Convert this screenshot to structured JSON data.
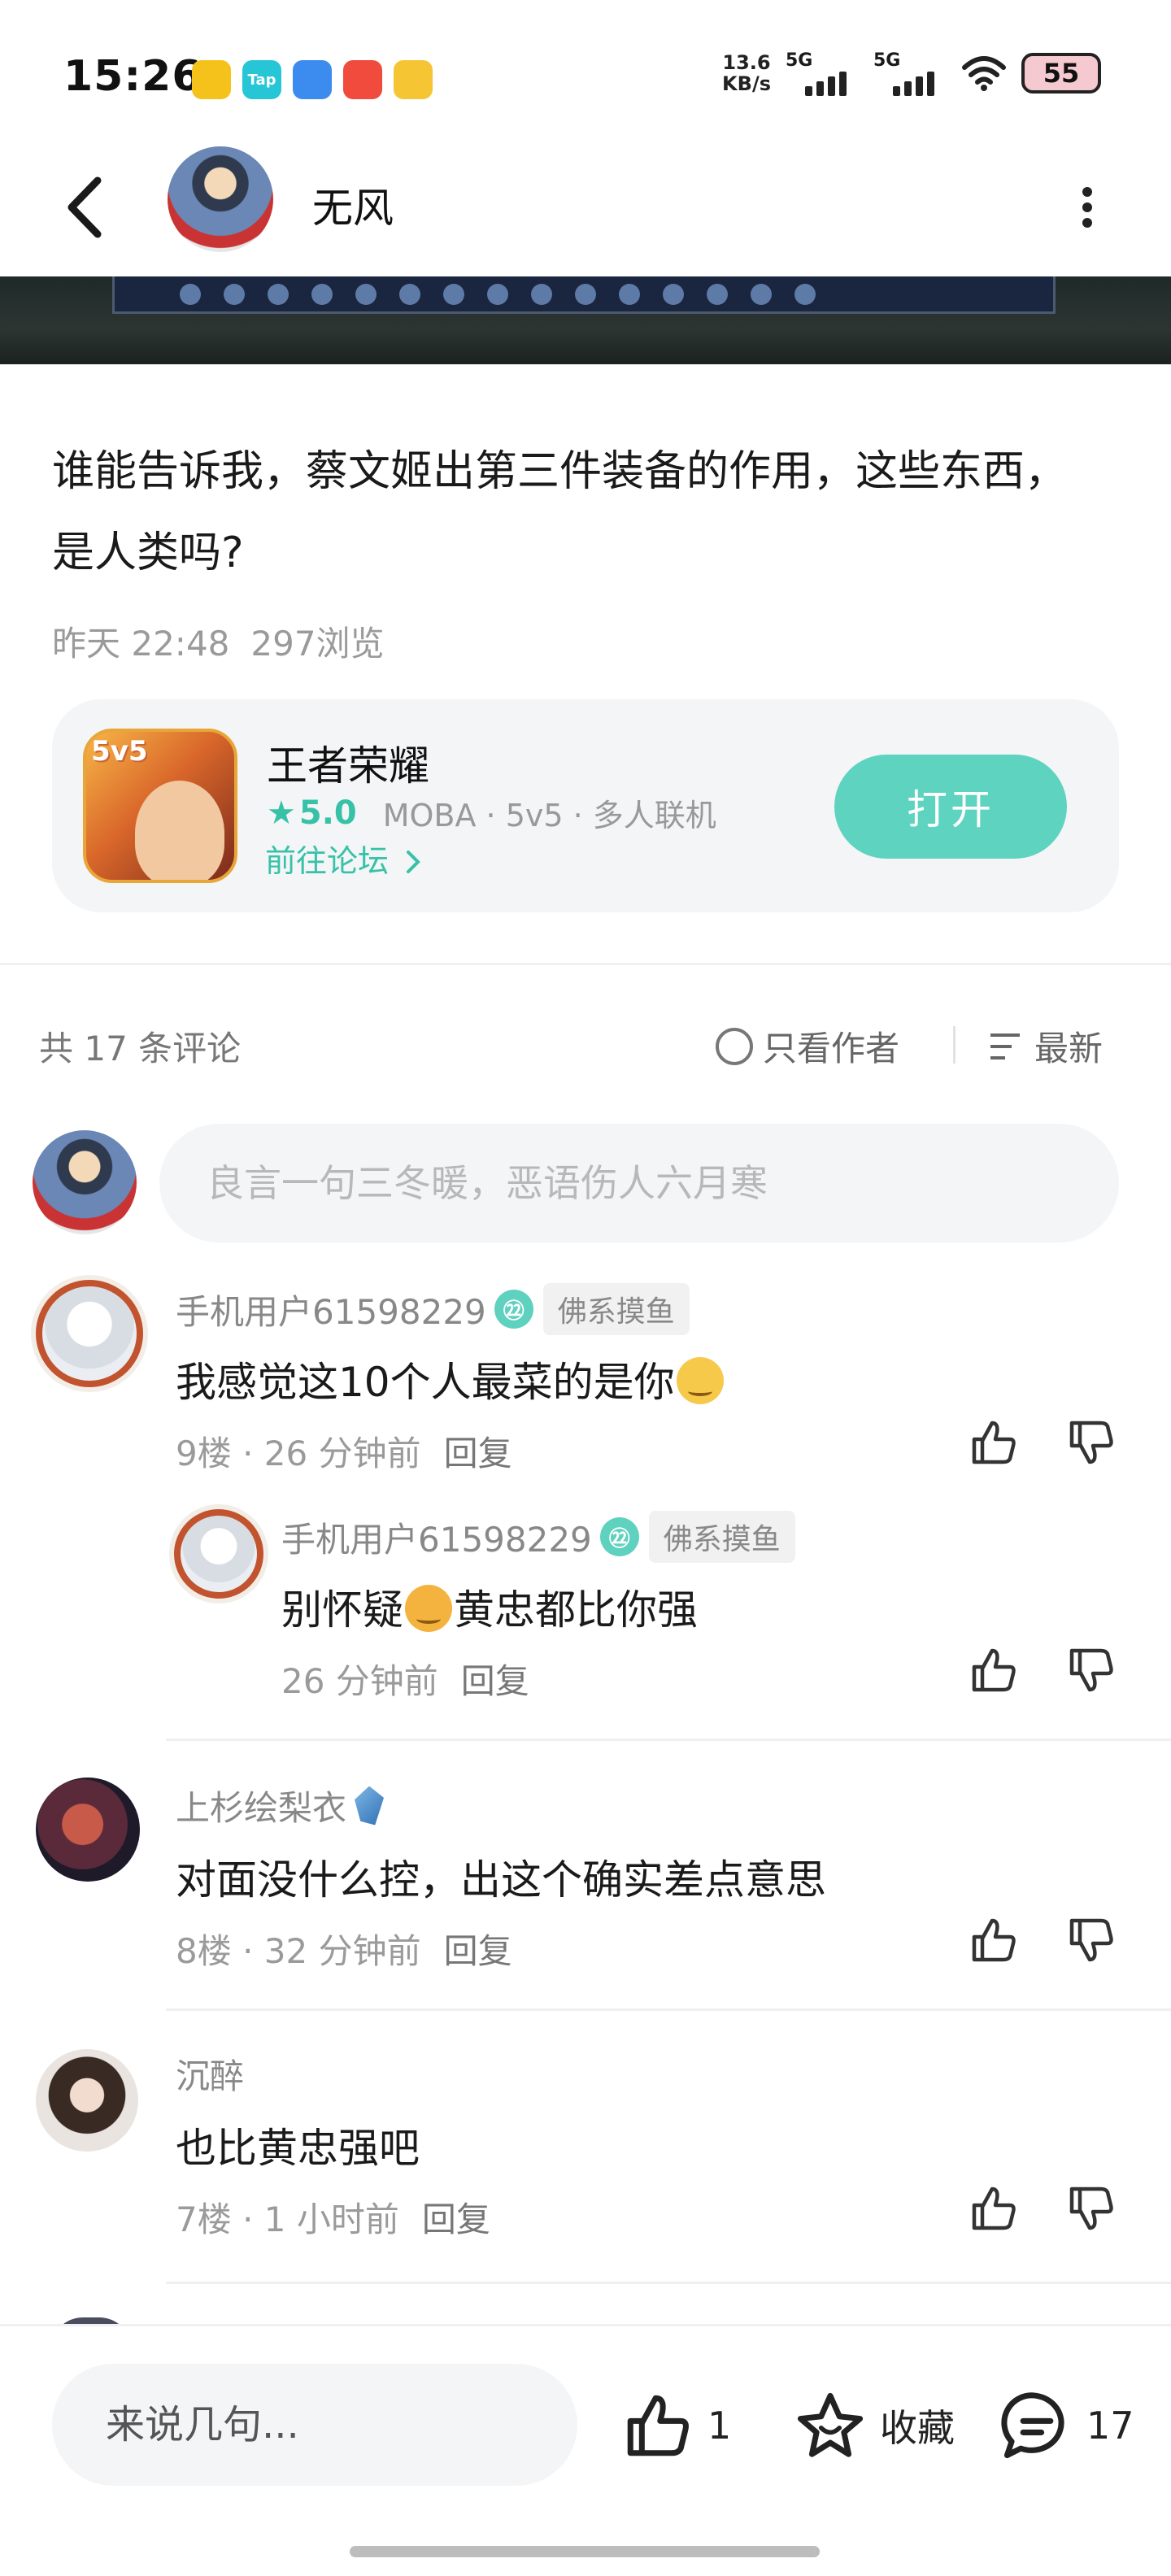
{
  "status_bar": {
    "time": "15:26",
    "net_speed_value": "13.6",
    "net_speed_unit": "KB/s",
    "sim1_gen": "5G",
    "sim2_gen": "5G",
    "battery": "55",
    "app_icons": [
      "app-icon-1",
      "app-icon-tap",
      "app-icon-3",
      "app-icon-4",
      "app-icon-5"
    ],
    "tap_label": "Tap"
  },
  "header": {
    "author_name": "无风"
  },
  "post": {
    "title": "谁能告诉我，蔡文姬出第三件装备的作用，这些东西，是人类吗?",
    "time": "昨天 22:48",
    "views": "297浏览"
  },
  "game_card": {
    "icon_tag": "5v5",
    "name": "王者荣耀",
    "rating": "5.0",
    "tags": "MOBA · 5v5 · 多人联机",
    "forum_link": "前往论坛",
    "open_label": "打开",
    "accent_color": "#37c2a8"
  },
  "comments_header": {
    "count_label": "共 17 条评论",
    "author_only_label": "只看作者",
    "sort_label": "最新"
  },
  "comment_input": {
    "placeholder": "良言一句三冬暖，恶语伤人六月寒"
  },
  "comments": [
    {
      "user": "手机用户61598229",
      "level_badge": "㉒",
      "title_badge": "佛系摸鱼",
      "text_before": "我感觉这10个人最菜的是你",
      "text_after": "",
      "floor": "9楼",
      "time": "26 分钟前",
      "reply": "回复"
    },
    {
      "user": "手机用户61598229",
      "level_badge": "㉒",
      "title_badge": "佛系摸鱼",
      "text_before": "别怀疑",
      "text_after": "黄忠都比你强",
      "time": "26 分钟前",
      "reply": "回复"
    },
    {
      "user": "上杉绘梨衣",
      "text_before": "对面没什么控，出这个确实差点意思",
      "floor": "8楼",
      "time": "32 分钟前",
      "reply": "回复"
    },
    {
      "user": "沉醉",
      "text_before": "也比黄忠强吧",
      "floor": "7楼",
      "time": "1 小时前",
      "reply": "回复"
    }
  ],
  "bottom_bar": {
    "input_placeholder": "来说几句...",
    "like_count": "1",
    "favorite_label": "收藏",
    "comment_count": "17"
  }
}
